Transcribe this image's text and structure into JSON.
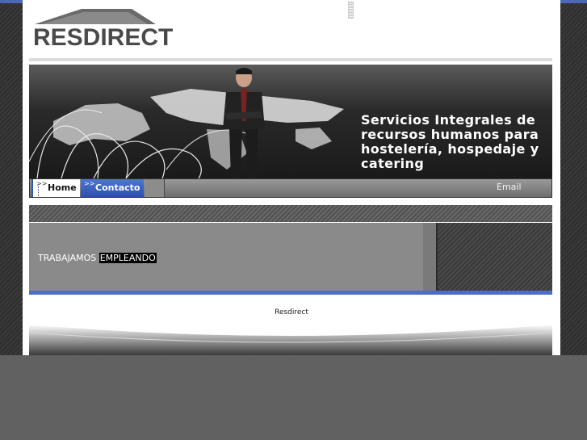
{
  "header": {
    "logo_text": "RESDIRECT"
  },
  "banner": {
    "tagline_line1": "Servicios Integrales de",
    "tagline_line2": "recursos humanos para",
    "tagline_line3": "hostelería, hospedaje y",
    "tagline_line4": "catering"
  },
  "nav": {
    "home_label": "Home",
    "contact_label": "Contacto",
    "email_label": "Email",
    "arrow_glyph": ">>"
  },
  "content": {
    "text_plain": "TRABAJAMOS ",
    "text_highlight": "EMPLEANDO"
  },
  "footer": {
    "text": "Resdirect"
  },
  "colors": {
    "accent_blue": "#4d6dc8",
    "page_bg": "#616161",
    "logo_gray": "#4a4a4a"
  }
}
